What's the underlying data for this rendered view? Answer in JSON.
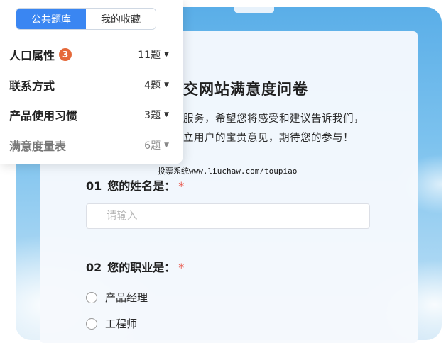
{
  "sidebar": {
    "tabs": [
      {
        "label": "公共题库",
        "active": true
      },
      {
        "label": "我的收藏",
        "active": false
      }
    ],
    "categories": [
      {
        "name": "人口属性",
        "badge": "3",
        "count": "11题"
      },
      {
        "name": "联系方式",
        "count": "4题"
      },
      {
        "name": "产品使用习惯",
        "count": "3题"
      },
      {
        "name": "满意度量表",
        "count": "6题"
      }
    ],
    "caret": "▼"
  },
  "form": {
    "title": "交网站满意度问卷",
    "desc_line1": "服务，希望您将感受和建议告诉我们，",
    "desc_line2": "立用户的宝贵意见，期待您的参与！",
    "watermark": "投票系统www.liuchaw.com/toupiao",
    "questions": [
      {
        "num": "01",
        "label": "您的姓名是：",
        "required_mark": "*",
        "placeholder": "请输入"
      },
      {
        "num": "02",
        "label": "您的职业是：",
        "required_mark": "*",
        "options": [
          "产品经理",
          "工程师"
        ]
      }
    ]
  },
  "colors": {
    "accent": "#3a86f2",
    "badge": "#e5693a",
    "required": "#e85a4f"
  }
}
